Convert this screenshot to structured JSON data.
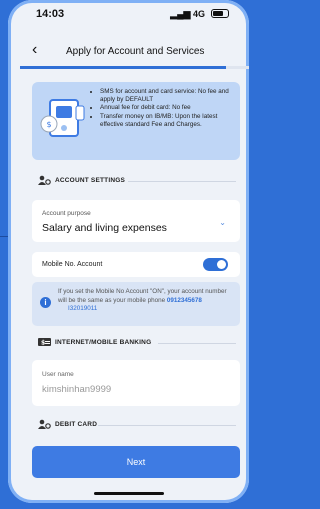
{
  "status_bar": {
    "time": "14:03",
    "signal": "4G"
  },
  "header": {
    "back_icon": "chevron-left-icon",
    "title": "Apply for Account and Services"
  },
  "progress_fraction": 0.9,
  "info": {
    "bullets": [
      "SMS for account and card service: No fee and apply by DEFAULT",
      "Annual fee for debit card: No fee",
      "Transfer money on IB/MB: Upon the latest effective standard Fee and Charges."
    ]
  },
  "sections": {
    "account_settings": "ACCOUNT SETTINGS",
    "internet_banking": "INTERNET/MOBILE BANKING",
    "debit_card": "DEBIT CARD"
  },
  "account_purpose": {
    "label": "Account purpose",
    "value": "Salary and living expenses"
  },
  "mobile_no_account": {
    "label": "Mobile No. Account",
    "on": true
  },
  "note": {
    "text": "If you set the Mobile No Account \"ON\", your account number will be the same as your mobile phone",
    "phone": "0912345678",
    "account": "I32019011"
  },
  "username": {
    "label": "User name",
    "value": "kimshinhan9999"
  },
  "next_label": "Next",
  "colors": {
    "accent": "#2F6FD6",
    "info_bg": "#BFD6F6"
  }
}
